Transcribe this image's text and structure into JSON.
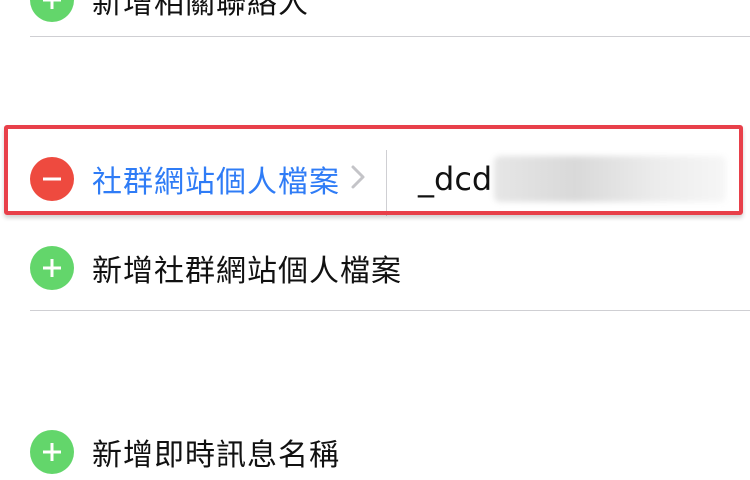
{
  "rows": {
    "top_partial": {
      "label": "新增相關聯絡人",
      "button": "add"
    },
    "social_profile": {
      "label": "社群網站個人檔案",
      "value": "_dcd",
      "value_redacted": true,
      "button": "remove"
    },
    "add_social_profile": {
      "label": "新增社群網站個人檔案",
      "button": "add"
    },
    "add_instant_message": {
      "label": "新增即時訊息名稱",
      "button": "add"
    }
  },
  "icons": {
    "add": "plus-circle-icon",
    "remove": "minus-circle-icon",
    "chevron": "chevron-right-icon"
  },
  "colors": {
    "add_green": "#63d66b",
    "remove_red": "#ee4a3f",
    "link_blue": "#2f7cf6",
    "highlight_red": "#e8404a",
    "separator": "#cfcfd3"
  }
}
